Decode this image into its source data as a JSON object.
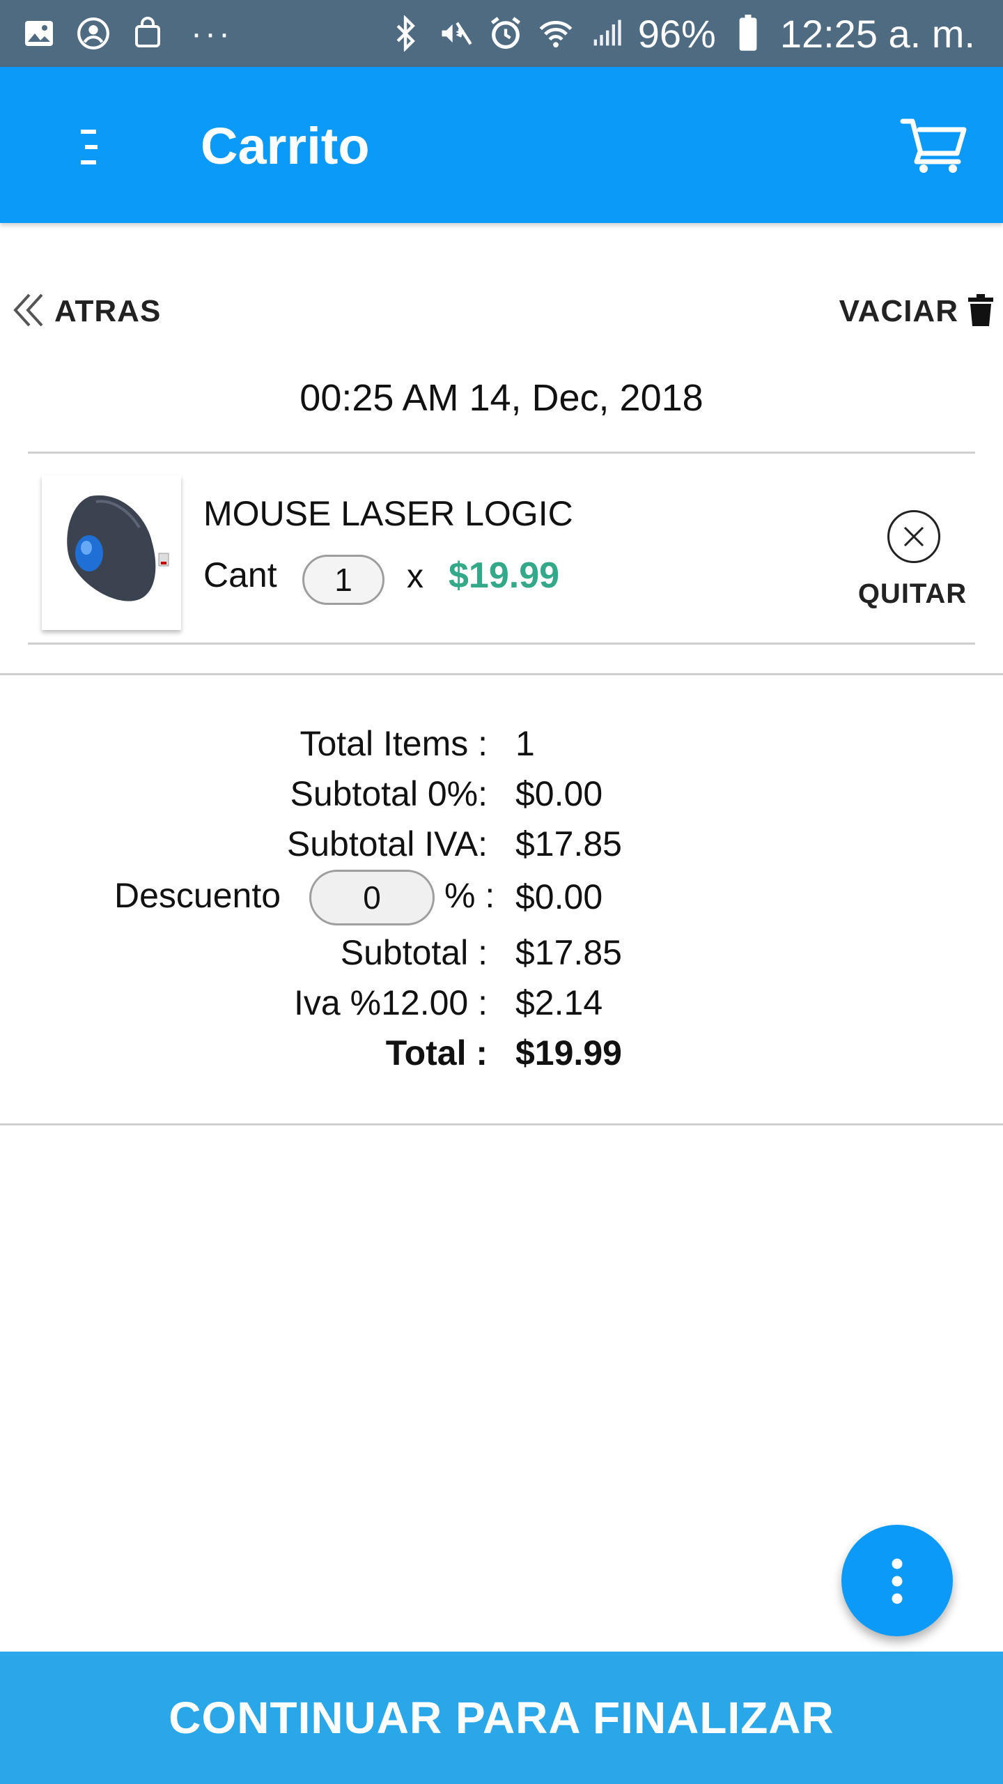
{
  "status_bar": {
    "battery": "96%",
    "time": "12:25 a. m.",
    "overflow": "···",
    "icons": [
      "image-icon",
      "account-icon",
      "shopping-bag-icon",
      "bluetooth-icon",
      "vibrate-icon",
      "alarm-icon",
      "wifi-icon",
      "signal-icon",
      "battery-icon"
    ]
  },
  "appbar": {
    "title": "Carrito",
    "color": "#0b9af8"
  },
  "actions": {
    "back_label": "ATRAS",
    "clear_label": "VACIAR"
  },
  "datetime": "00:25 AM 14, Dec, 2018",
  "items": [
    {
      "name": "MOUSE LASER LOGIC",
      "qty_label": "Cant",
      "qty": "1",
      "times": "x",
      "price": "$19.99",
      "remove_label": "QUITAR"
    }
  ],
  "summary": {
    "total_items_label": "Total Items :",
    "total_items": "1",
    "subtotal0_label": "Subtotal 0%:",
    "subtotal0": "$0.00",
    "subtotal_iva_label": "Subtotal IVA:",
    "subtotal_iva": "$17.85",
    "discount_label": "Descuento",
    "discount_value": "0",
    "discount_suffix": "% :",
    "discount_amount": "$0.00",
    "subtotal_label": "Subtotal :",
    "subtotal": "$17.85",
    "iva_label": "Iva %12.00 :",
    "iva": "$2.14",
    "total_label": "Total :",
    "total": "$19.99"
  },
  "continue_label": "CONTINUAR PARA FINALIZAR",
  "colors": {
    "accent": "#0b9af8",
    "price": "#34a98a",
    "bottom_button": "#2aa7e8",
    "status_bar": "#4f6b82"
  }
}
